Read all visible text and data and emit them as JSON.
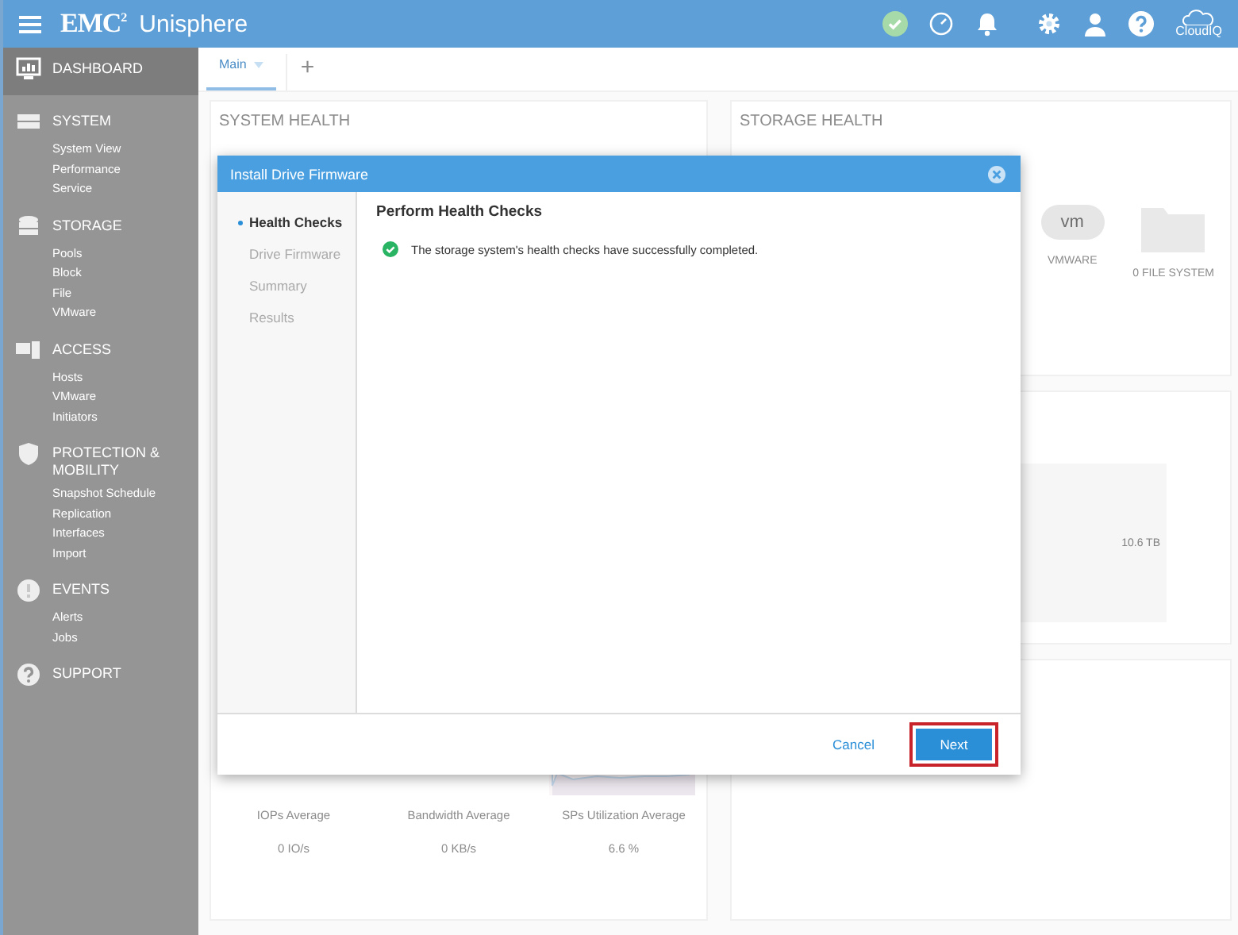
{
  "header": {
    "logo": "EMC$^{2}$",
    "product": "Unisphere",
    "cloud_label": "CloudIQ"
  },
  "sidebar": {
    "items": [
      {
        "label": "DASHBOARD",
        "selected": true
      },
      {
        "label": "SYSTEM",
        "selected": false,
        "children": [
          {
            "label": "System View"
          },
          {
            "label": "Performance"
          },
          {
            "label": "Service"
          }
        ]
      },
      {
        "label": "STORAGE",
        "selected": false,
        "children": [
          {
            "label": "Pools"
          },
          {
            "label": "Block"
          },
          {
            "label": "File"
          },
          {
            "label": "VMware"
          }
        ]
      },
      {
        "label": "ACCESS",
        "selected": false,
        "children": [
          {
            "label": "Hosts"
          },
          {
            "label": "VMware"
          },
          {
            "label": "Initiators"
          }
        ]
      },
      {
        "label": "PROTECTION & MOBILITY",
        "selected": false,
        "children": [
          {
            "label": "Snapshot Schedule"
          },
          {
            "label": "Replication"
          },
          {
            "label": "Interfaces"
          },
          {
            "label": "Import"
          }
        ]
      },
      {
        "label": "EVENTS",
        "selected": false,
        "children": [
          {
            "label": "Alerts"
          },
          {
            "label": "Jobs"
          }
        ]
      },
      {
        "label": "SUPPORT",
        "selected": false
      }
    ]
  },
  "tabs": [
    {
      "label": "Main",
      "selected": true
    }
  ],
  "add_tab": "+",
  "system_health": {
    "title": "SYSTEM HEALTH",
    "metrics": [
      {
        "label": "IOPs Average",
        "value": "0 IO/s"
      },
      {
        "label": "Bandwidth Average",
        "value": "0 KB/s"
      },
      {
        "label": "SPs Utilization Average",
        "value": "6.6 %"
      }
    ]
  },
  "storage_health": {
    "title": "STORAGE HEALTH",
    "cloud_text": "vm",
    "tiles": [
      {
        "label": "VMWARE"
      },
      {
        "label": "0 FILE SYSTEM"
      }
    ]
  },
  "capacity": {
    "reading": "10.6 TB"
  },
  "dialog": {
    "title": "Install Drive Firmware",
    "steps": [
      {
        "label": "Health Checks",
        "selected": true
      },
      {
        "label": "Drive Firmware",
        "selected": false
      },
      {
        "label": "Summary",
        "selected": false
      },
      {
        "label": "Results",
        "selected": false
      }
    ],
    "heading": "Perform Health Checks",
    "message": "The storage system's health checks have successfully completed.",
    "buttons": [
      {
        "label": "Cancel",
        "kind": "link",
        "focused": false
      },
      {
        "label": "Next",
        "kind": "primary",
        "focused": true
      }
    ]
  }
}
